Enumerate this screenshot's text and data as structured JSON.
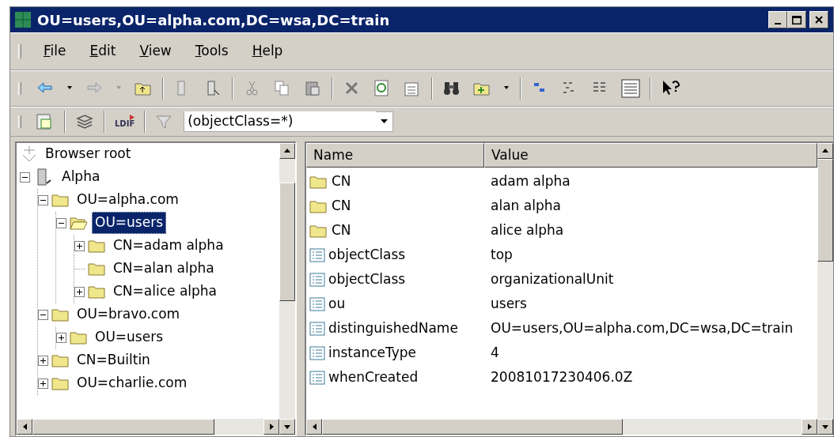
{
  "window": {
    "title": "OU=users,OU=alpha.com,DC=wsa,DC=train"
  },
  "menu": [
    {
      "label": "File"
    },
    {
      "label": "Edit"
    },
    {
      "label": "View"
    },
    {
      "label": "Tools"
    },
    {
      "label": "Help"
    }
  ],
  "ldif_button": {
    "label": "LDIF"
  },
  "filter": {
    "value": "(objectClass=*)"
  },
  "tree": [
    {
      "label": "Browser root",
      "kind": "root",
      "selected": false
    },
    {
      "label": "Alpha",
      "kind": "server",
      "expanded": true,
      "selected": false,
      "children": [
        {
          "label": "OU=alpha.com",
          "kind": "folder",
          "expanded": true,
          "selected": false,
          "children": [
            {
              "label": "OU=users",
              "kind": "folder",
              "expanded": true,
              "selected": true,
              "children": [
                {
                  "label": "CN=adam alpha",
                  "kind": "folder",
                  "expanded": false,
                  "selected": false
                },
                {
                  "label": "CN=alan  alpha",
                  "kind": "folder",
                  "selected": false
                },
                {
                  "label": "CN=alice  alpha",
                  "kind": "folder",
                  "expanded": false,
                  "selected": false
                }
              ]
            }
          ]
        },
        {
          "label": "OU=bravo.com",
          "kind": "folder",
          "expanded": true,
          "selected": false,
          "children": [
            {
              "label": "OU=users",
              "kind": "folder",
              "expanded": false,
              "selected": false
            }
          ]
        },
        {
          "label": "CN=Builtin",
          "kind": "folder",
          "expanded": false,
          "selected": false
        },
        {
          "label": "OU=charlie.com",
          "kind": "folder",
          "expanded": false,
          "selected": false
        }
      ]
    }
  ],
  "table": {
    "columns": [
      "Name",
      "Value"
    ],
    "rows": [
      {
        "kind": "folder",
        "name": "CN",
        "value": "adam alpha"
      },
      {
        "kind": "folder",
        "name": "CN",
        "value": "alan  alpha"
      },
      {
        "kind": "folder",
        "name": "CN",
        "value": "alice  alpha"
      },
      {
        "kind": "attribute",
        "name": "objectClass",
        "value": "top"
      },
      {
        "kind": "attribute",
        "name": "objectClass",
        "value": "organizationalUnit"
      },
      {
        "kind": "attribute",
        "name": "ou",
        "value": "users"
      },
      {
        "kind": "attribute",
        "name": "distinguishedName",
        "value": "OU=users,OU=alpha.com,DC=wsa,DC=train"
      },
      {
        "kind": "attribute",
        "name": "instanceType",
        "value": "4"
      },
      {
        "kind": "attribute",
        "name": "whenCreated",
        "value": "20081017230406.0Z"
      }
    ]
  }
}
